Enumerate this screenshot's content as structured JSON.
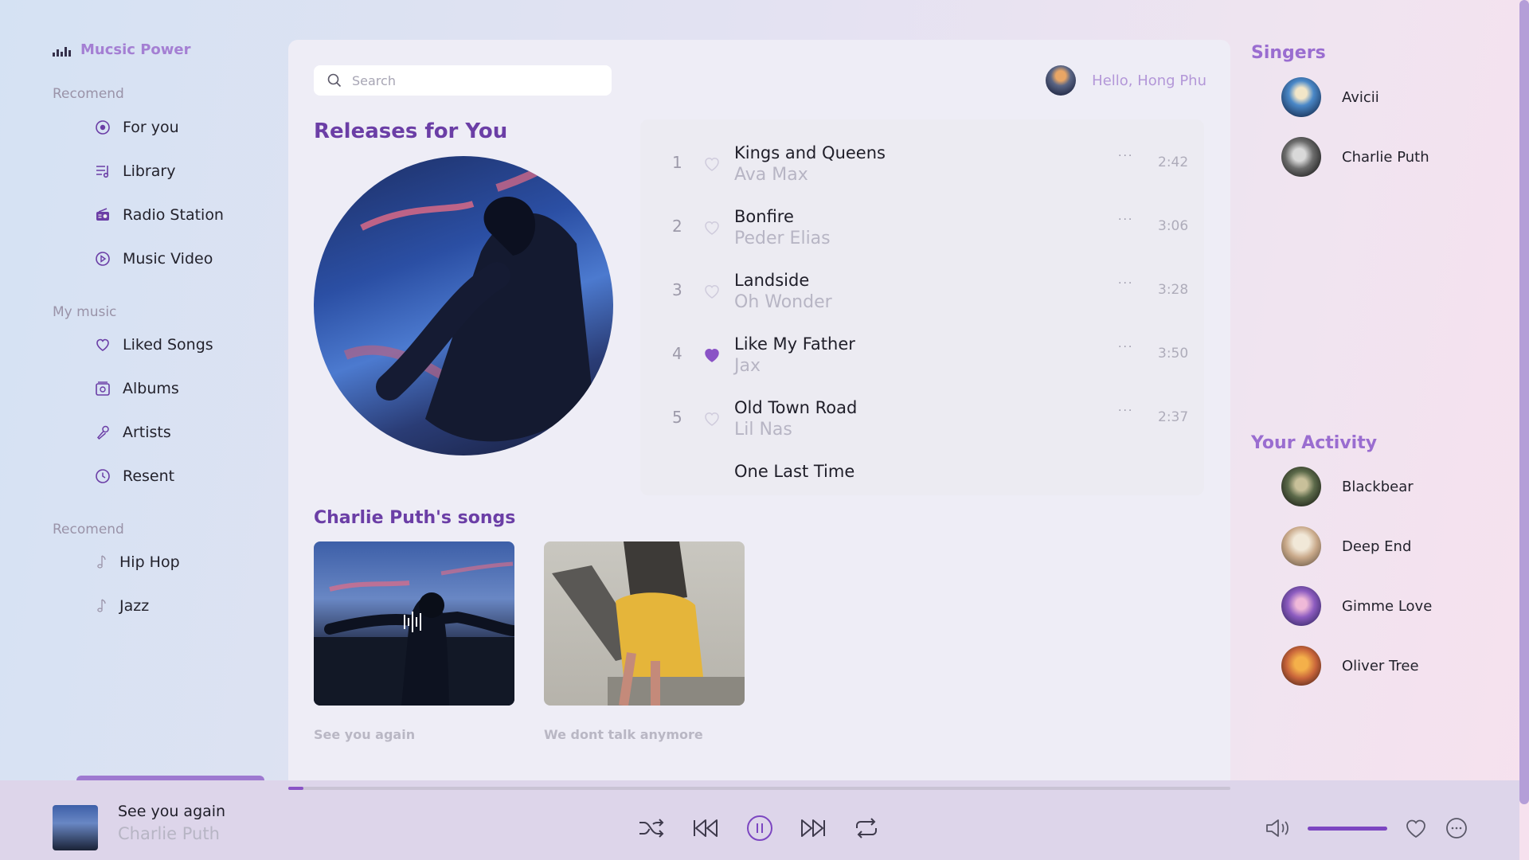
{
  "brand": {
    "name": "Mucsic Power"
  },
  "sidebar": {
    "sections": [
      {
        "heading": "Recomend",
        "items": [
          {
            "label": "For you",
            "icon": "target-icon"
          },
          {
            "label": "Library",
            "icon": "playlist-icon"
          },
          {
            "label": "Radio Station",
            "icon": "radio-icon"
          },
          {
            "label": "Music Video",
            "icon": "play-circle-icon"
          }
        ]
      },
      {
        "heading": "My music",
        "items": [
          {
            "label": "Liked Songs",
            "icon": "heart-icon"
          },
          {
            "label": "Albums",
            "icon": "album-icon"
          },
          {
            "label": "Artists",
            "icon": "microphone-icon"
          },
          {
            "label": "Resent",
            "icon": "clock-icon"
          }
        ]
      },
      {
        "heading": "Recomend",
        "items": [
          {
            "label": "Hip Hop",
            "icon": "music-note-icon"
          },
          {
            "label": "Jazz",
            "icon": "music-note-icon"
          }
        ]
      }
    ]
  },
  "header": {
    "search_placeholder": "Search",
    "greeting": "Hello, Hong Phu"
  },
  "releases": {
    "title": "Releases for You",
    "tracks": [
      {
        "num": "1",
        "title": "Kings and Queens",
        "artist": "Ava Max",
        "duration": "2:42",
        "liked": false,
        "more": "···"
      },
      {
        "num": "2",
        "title": "Bonfire",
        "artist": "Peder Elias",
        "duration": "3:06",
        "liked": false,
        "more": "···"
      },
      {
        "num": "3",
        "title": "Landside",
        "artist": "Oh Wonder",
        "duration": "3:28",
        "liked": false,
        "more": "···"
      },
      {
        "num": "4",
        "title": "Like My Father",
        "artist": "Jax",
        "duration": "3:50",
        "liked": true,
        "more": "···"
      },
      {
        "num": "5",
        "title": "Old Town Road",
        "artist": "Lil Nas",
        "duration": "2:37",
        "liked": false,
        "more": "···"
      },
      {
        "num": "",
        "title": "One Last Time",
        "artist": "",
        "duration": "",
        "liked": false,
        "more": ""
      }
    ]
  },
  "artist_songs": {
    "title": "Charlie Puth's songs",
    "songs": [
      {
        "label": "See you again"
      },
      {
        "label": "We dont talk anymore"
      }
    ]
  },
  "right_panel": {
    "singers_title": "Singers",
    "singers": [
      {
        "name": "Avicii"
      },
      {
        "name": "Charlie Puth"
      }
    ],
    "activity_title": "Your Activity",
    "activity": [
      {
        "name": "Blackbear"
      },
      {
        "name": "Deep End"
      },
      {
        "name": "Gimme Love"
      },
      {
        "name": "Oliver Tree"
      }
    ]
  },
  "player": {
    "title": "See you again",
    "artist": "Charlie Puth",
    "progress": 0.016,
    "volume": 1.0
  },
  "colors": {
    "accent": "#7c46c1",
    "heading": "#6b3ea6",
    "brand": "#a47fd3"
  }
}
